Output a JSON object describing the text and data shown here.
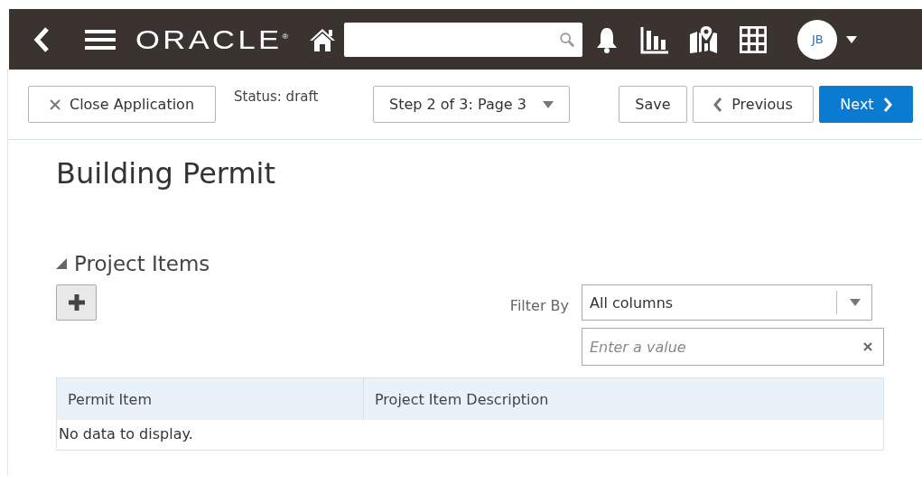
{
  "header": {
    "logo": "ORACLE",
    "logo_mark": "®",
    "avatar_initials": "JB"
  },
  "toolbar": {
    "close_button": "Close Application",
    "status": "Status: draft",
    "step_select": "Step 2 of 3: Page 3",
    "save_button": "Save",
    "previous_button": "Previous",
    "next_button": "Next"
  },
  "page_title": "Building Permit",
  "section": {
    "title": "Project Items",
    "expanded": true,
    "filter_label": "Filter By",
    "filter_select": "All columns",
    "filter_input": {
      "placeholder": "Enter a value"
    }
  },
  "table": {
    "columns": [
      "Permit Item",
      "Project Item Description"
    ],
    "empty_text": "No data to display."
  }
}
